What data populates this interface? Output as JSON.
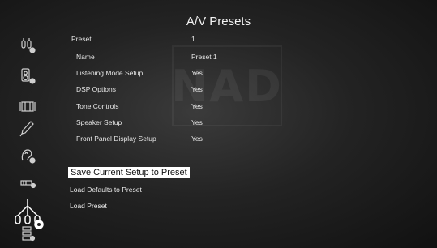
{
  "title": "A/V Presets",
  "preset": {
    "label": "Preset",
    "value": "1"
  },
  "settings": [
    {
      "label": "Name",
      "value": "Preset 1"
    },
    {
      "label": "Listening Mode Setup",
      "value": "Yes"
    },
    {
      "label": "DSP Options",
      "value": "Yes"
    },
    {
      "label": "Tone Controls",
      "value": "Yes"
    },
    {
      "label": "Speaker Setup",
      "value": "Yes"
    },
    {
      "label": "Front Panel Display Setup",
      "value": "Yes"
    }
  ],
  "actions": [
    {
      "label": "Save Current Setup to Preset",
      "selected": true
    },
    {
      "label": "Load Defaults to Preset",
      "selected": false
    },
    {
      "label": "Load Preset",
      "selected": false
    }
  ],
  "sidebar": {
    "icons": [
      "input-setup-icon",
      "speaker-setup-icon",
      "display-setup-icon",
      "pen-icon",
      "listening-mode-icon",
      "source-setup-icon",
      "av-presets-icon",
      "system-icon"
    ],
    "active": "av-presets-icon"
  },
  "watermark": "NAD"
}
